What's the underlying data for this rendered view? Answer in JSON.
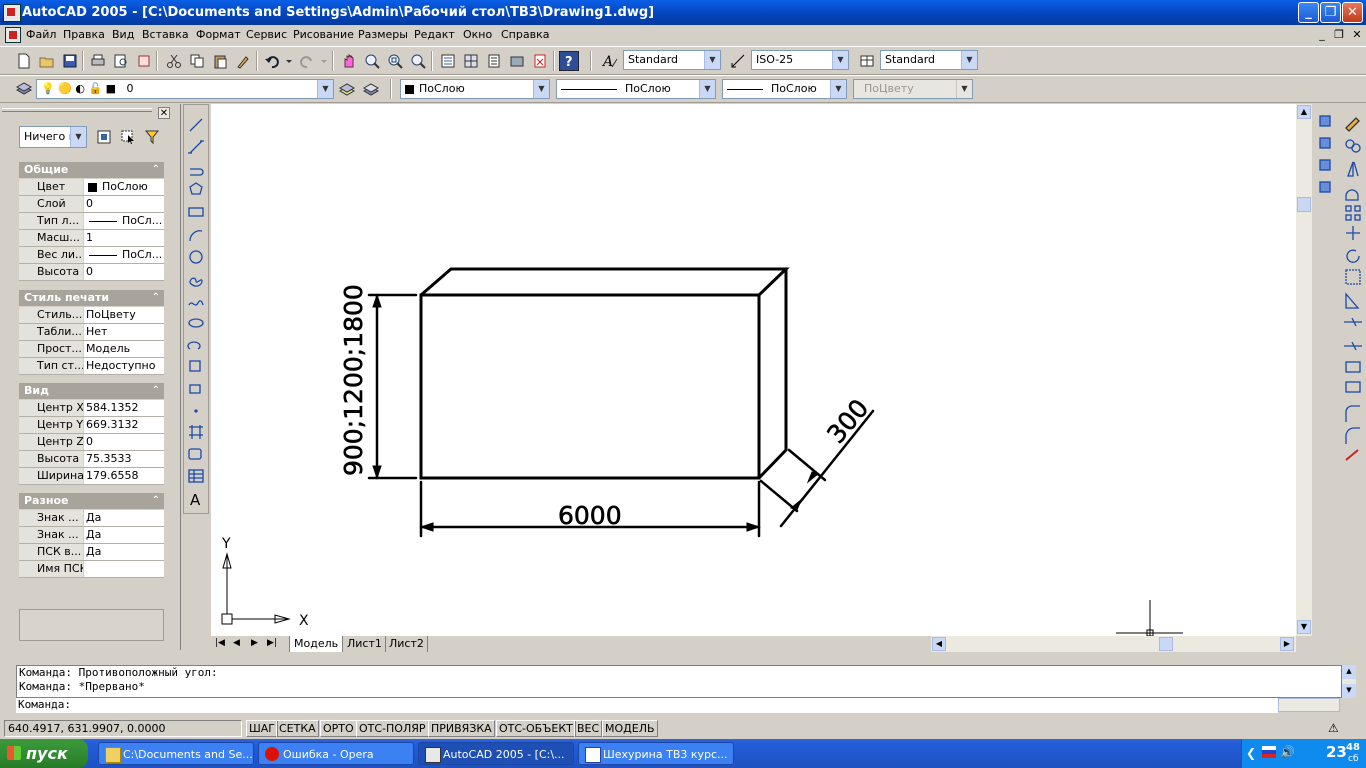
{
  "window": {
    "title": "AutoCAD 2005 - [C:\\Documents and Settings\\Admin\\Рабочий стол\\ТВ3\\Drawing1.dwg]",
    "minimize": "_",
    "restore": "❐",
    "close": "✕"
  },
  "menu": [
    "Файл",
    "Правка",
    "Вид",
    "Вставка",
    "Формат",
    "Сервис",
    "Рисование",
    "Размеры",
    "Редакт",
    "Окно",
    "Справка"
  ],
  "mdi": {
    "minimize": "_",
    "restore": "❐",
    "close": "✕"
  },
  "toolbar": {
    "text_style": "Standard",
    "dim_style": "ISO-25",
    "table_style": "Standard",
    "layer": "0",
    "color": "ПоСлою",
    "linetype": "ПоСлою",
    "lineweight": "ПоСлою",
    "plotstyle": "ПоЦвету"
  },
  "properties": {
    "selection": "Ничего н",
    "general": {
      "title": "Общие",
      "rows": [
        {
          "k": "Цвет",
          "v": "ПоСлою"
        },
        {
          "k": "Слой",
          "v": "0"
        },
        {
          "k": "Тип л...",
          "v": "ПоСл..."
        },
        {
          "k": "Масш...",
          "v": "1"
        },
        {
          "k": "Вес ли...",
          "v": "ПоСл..."
        },
        {
          "k": "Высота",
          "v": "0"
        }
      ]
    },
    "plot": {
      "title": "Стиль печати",
      "rows": [
        {
          "k": "Стиль...",
          "v": "ПоЦвету"
        },
        {
          "k": "Табли...",
          "v": "Нет"
        },
        {
          "k": "Прост...",
          "v": "Модель"
        },
        {
          "k": "Тип ст...",
          "v": "Недоступно"
        }
      ]
    },
    "view": {
      "title": "Вид",
      "rows": [
        {
          "k": "Центр X",
          "v": "584.1352"
        },
        {
          "k": "Центр Y",
          "v": "669.3132"
        },
        {
          "k": "Центр Z",
          "v": "0"
        },
        {
          "k": "Высота",
          "v": "75.3533"
        },
        {
          "k": "Ширина",
          "v": "179.6558"
        }
      ]
    },
    "misc": {
      "title": "Разное",
      "rows": [
        {
          "k": "Знак ...",
          "v": "Да"
        },
        {
          "k": "Знак ...",
          "v": "Да"
        },
        {
          "k": "ПСК в...",
          "v": "Да"
        },
        {
          "k": "Имя ПСК",
          "v": ""
        }
      ]
    }
  },
  "drawing": {
    "dim_width": "6000",
    "dim_height": "900;1200;1800",
    "dim_depth": "300",
    "ucs_x": "X",
    "ucs_y": "Y"
  },
  "tabs": [
    "Модель",
    "Лист1",
    "Лист2"
  ],
  "command": {
    "line1": "Команда: Противоположный угол:",
    "line2": "Команда: *Прервано*",
    "prompt": "Команда:"
  },
  "status": {
    "coords": "640.4917, 631.9907, 0.0000",
    "buttons": [
      "ШАГ",
      "СЕТКА",
      "ОРТО",
      "ОТС-ПОЛЯР",
      "ПРИВЯЗКА",
      "ОТС-ОБЪЕКТ",
      "ВЕС",
      "МОДЕЛЬ"
    ]
  },
  "taskbar": {
    "start": "пуск",
    "tasks": [
      "C:\\Documents and Se...",
      "Ошибка - Opera",
      "AutoCAD 2005 - [C:\\...",
      "Шехурина ТВ3 курс..."
    ],
    "time": "23",
    "time_min": "48",
    "day": "сб"
  }
}
